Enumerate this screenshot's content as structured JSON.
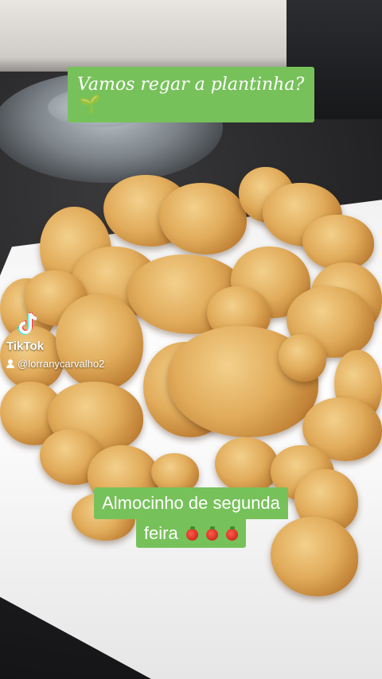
{
  "overlay": {
    "top_caption": "Vamos regar a plantinha?",
    "top_caption_emoji": "seedling-icon",
    "bottom_caption_line1": "Almocinho de segunda",
    "bottom_caption_line2": "feira",
    "bottom_caption_emoji": "tomato-icon",
    "caption_bg_color": "#77c15a"
  },
  "watermark": {
    "brand": "TikTok",
    "username": "@lorranycarvalho2",
    "user_icon": "user-icon",
    "logo_icon": "tiktok-logo-icon"
  }
}
